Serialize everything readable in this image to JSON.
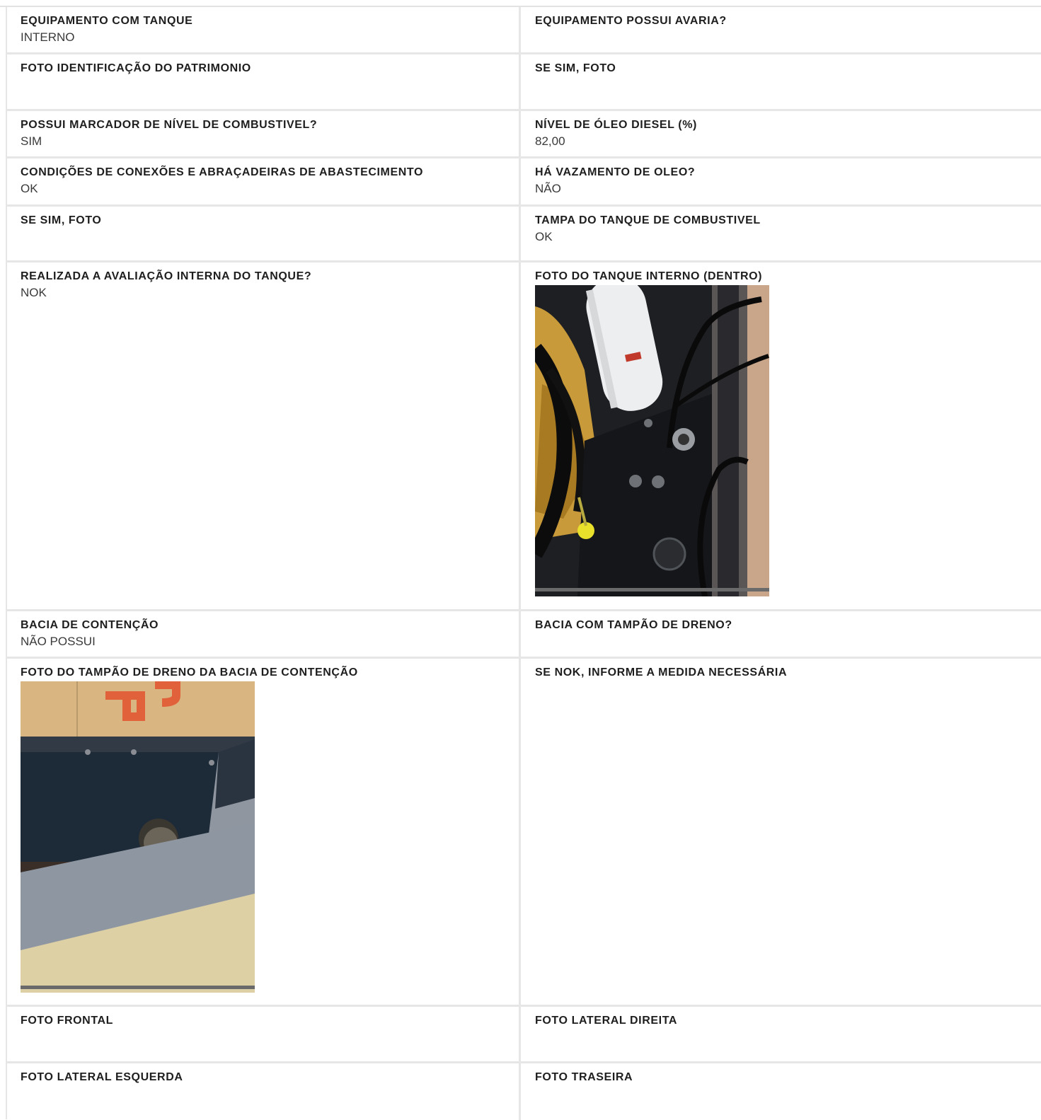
{
  "rows": [
    {
      "left": {
        "label": "EQUIPAMENTO COM TANQUE",
        "value": "INTERNO"
      },
      "right": {
        "label": "EQUIPAMENTO POSSUI AVARIA?",
        "value": ""
      }
    },
    {
      "left": {
        "label": "FOTO IDENTIFICAÇÃO DO PATRIMONIO",
        "value": ""
      },
      "right": {
        "label": "SE SIM, FOTO",
        "value": ""
      }
    },
    {
      "left": {
        "label": "POSSUI MARCADOR DE NÍVEL DE COMBUSTIVEL?",
        "value": "SIM"
      },
      "right": {
        "label": "NÍVEL DE ÓLEO DIESEL (%)",
        "value": "82,00"
      }
    },
    {
      "left": {
        "label": "CONDIÇÕES DE CONEXÕES E ABRAÇADEIRAS DE ABASTECIMENTO",
        "value": "OK"
      },
      "right": {
        "label": "HÁ VAZAMENTO DE OLEO?",
        "value": "NÃO"
      }
    },
    {
      "left": {
        "label": "SE SIM, FOTO",
        "value": ""
      },
      "right": {
        "label": "TAMPA DO TANQUE DE COMBUSTIVEL",
        "value": "OK"
      }
    },
    {
      "left": {
        "label": "REALIZADA A AVALIAÇÃO INTERNA DO TANQUE?",
        "value": "NOK"
      },
      "right": {
        "label": "FOTO DO TANQUE INTERNO (DENTRO)",
        "value": ""
      }
    },
    {
      "left": {
        "label": "BACIA DE CONTENÇÃO",
        "value": "NÃO POSSUI"
      },
      "right": {
        "label": "BACIA COM TAMPÃO DE DRENO?",
        "value": ""
      }
    },
    {
      "left": {
        "label": "FOTO DO TAMPÃO DE DRENO DA BACIA DE CONTENÇÃO",
        "value": ""
      },
      "right": {
        "label": "SE NOK, INFORME A MEDIDA NECESSÁRIA",
        "value": ""
      }
    },
    {
      "left": {
        "label": "FOTO FRONTAL",
        "value": ""
      },
      "right": {
        "label": "FOTO LATERAL DIREITA",
        "value": ""
      }
    },
    {
      "left": {
        "label": "FOTO LATERAL ESQUERDA",
        "value": ""
      },
      "right": {
        "label": "FOTO TRASEIRA",
        "value": ""
      }
    }
  ]
}
